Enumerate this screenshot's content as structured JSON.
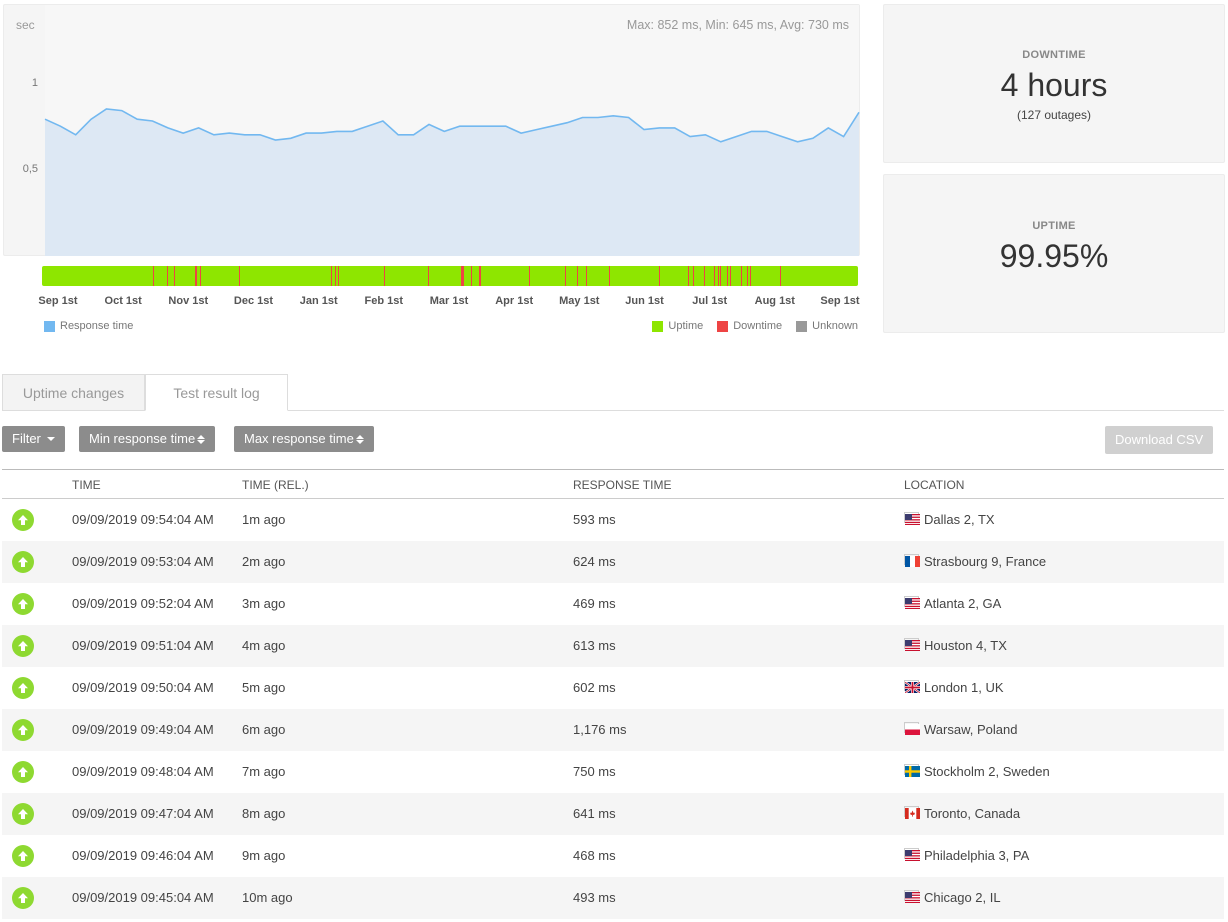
{
  "chart_data": {
    "type": "area",
    "ylabel": "sec",
    "yticks": [
      {
        "value": 1,
        "label": "1"
      },
      {
        "value": 0.5,
        "label": "0,5"
      }
    ],
    "ylim": [
      0,
      1.45
    ],
    "stats": "Max: 852 ms, Min: 645 ms, Avg: 730 ms",
    "x_months": [
      "Sep 1st",
      "Oct 1st",
      "Nov 1st",
      "Dec 1st",
      "Jan 1st",
      "Feb 1st",
      "Mar 1st",
      "Apr 1st",
      "May 1st",
      "Jun 1st",
      "Jul 1st",
      "Aug 1st",
      "Sep 1st"
    ],
    "series": [
      {
        "name": "Response time",
        "color": "#72b8f0",
        "values": [
          0.79,
          0.75,
          0.7,
          0.79,
          0.85,
          0.84,
          0.79,
          0.78,
          0.74,
          0.71,
          0.74,
          0.7,
          0.71,
          0.7,
          0.7,
          0.67,
          0.68,
          0.71,
          0.71,
          0.72,
          0.72,
          0.75,
          0.78,
          0.7,
          0.7,
          0.76,
          0.72,
          0.75,
          0.75,
          0.75,
          0.75,
          0.71,
          0.73,
          0.75,
          0.77,
          0.8,
          0.8,
          0.81,
          0.8,
          0.73,
          0.74,
          0.74,
          0.69,
          0.7,
          0.66,
          0.69,
          0.72,
          0.72,
          0.69,
          0.66,
          0.68,
          0.74,
          0.69,
          0.83
        ]
      }
    ],
    "status_bar": {
      "uptime_color": "#8ee600",
      "downtime_color": "#ee4444",
      "outage_positions_fraction": [
        0.136,
        0.153,
        0.162,
        0.188,
        0.193,
        0.241,
        0.354,
        0.359,
        0.363,
        0.419,
        0.473,
        0.514,
        0.516,
        0.526,
        0.536,
        0.597,
        0.641,
        0.656,
        0.667,
        0.695,
        0.756,
        0.791,
        0.798,
        0.811,
        0.823,
        0.828,
        0.831,
        0.839,
        0.843,
        0.857,
        0.864,
        0.868,
        0.904
      ]
    },
    "legend": [
      {
        "label": "Response time",
        "color": "#72b8f0"
      },
      {
        "label": "Uptime",
        "color": "#8ee600"
      },
      {
        "label": "Downtime",
        "color": "#ee4444"
      },
      {
        "label": "Unknown",
        "color": "#999999"
      }
    ]
  },
  "downtime": {
    "label": "DOWNTIME",
    "value": "4 hours",
    "sub": "(127 outages)"
  },
  "uptime": {
    "label": "UPTIME",
    "value": "99.95%"
  },
  "tabs": [
    {
      "label": "Uptime changes"
    },
    {
      "label": "Test result log"
    }
  ],
  "toolbar": {
    "filter_label": "Filter",
    "min_label": "Min response time",
    "max_label": "Max response time",
    "csv_label": "Download CSV"
  },
  "table": {
    "headers": [
      "TIME",
      "TIME (REL.)",
      "RESPONSE TIME",
      "LOCATION"
    ],
    "rows": [
      {
        "time": "09/09/2019 09:54:04 AM",
        "rel": "1m ago",
        "response": "593 ms",
        "location": "Dallas 2, TX",
        "flag": "us-flag-icon"
      },
      {
        "time": "09/09/2019 09:53:04 AM",
        "rel": "2m ago",
        "response": "624 ms",
        "location": "Strasbourg 9, France",
        "flag": "fr-flag-icon"
      },
      {
        "time": "09/09/2019 09:52:04 AM",
        "rel": "3m ago",
        "response": "469 ms",
        "location": "Atlanta 2, GA",
        "flag": "us-flag-icon"
      },
      {
        "time": "09/09/2019 09:51:04 AM",
        "rel": "4m ago",
        "response": "613 ms",
        "location": "Houston 4, TX",
        "flag": "us-flag-icon"
      },
      {
        "time": "09/09/2019 09:50:04 AM",
        "rel": "5m ago",
        "response": "602 ms",
        "location": "London 1, UK",
        "flag": "uk-flag-icon"
      },
      {
        "time": "09/09/2019 09:49:04 AM",
        "rel": "6m ago",
        "response": "1,176 ms",
        "location": "Warsaw, Poland",
        "flag": "pl-flag-icon"
      },
      {
        "time": "09/09/2019 09:48:04 AM",
        "rel": "7m ago",
        "response": "750 ms",
        "location": "Stockholm 2, Sweden",
        "flag": "se-flag-icon"
      },
      {
        "time": "09/09/2019 09:47:04 AM",
        "rel": "8m ago",
        "response": "641 ms",
        "location": "Toronto, Canada",
        "flag": "ca-flag-icon"
      },
      {
        "time": "09/09/2019 09:46:04 AM",
        "rel": "9m ago",
        "response": "468 ms",
        "location": "Philadelphia 3, PA",
        "flag": "us-flag-icon"
      },
      {
        "time": "09/09/2019 09:45:04 AM",
        "rel": "10m ago",
        "response": "493 ms",
        "location": "Chicago 2, IL",
        "flag": "us-flag-icon"
      }
    ]
  }
}
